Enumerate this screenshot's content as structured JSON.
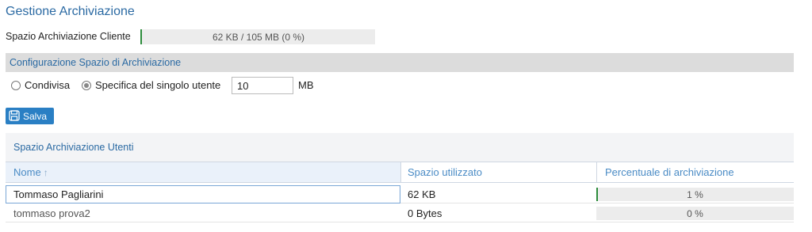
{
  "page": {
    "title": "Gestione Archiviazione"
  },
  "client_quota": {
    "label": "Spazio Archiviazione Cliente",
    "usage_text": "62 KB / 105 MB (0 %)",
    "used_fraction": 0.0
  },
  "storage_config": {
    "section_title": "Configurazione Spazio di Archiviazione",
    "options": [
      {
        "label": "Condivisa",
        "selected": false
      },
      {
        "label": "Specifica del singolo utente",
        "selected": true
      }
    ],
    "per_user_value": "10",
    "unit": "MB",
    "save_label": "Salva"
  },
  "users": {
    "section_title": "Spazio Archiviazione Utenti",
    "columns": {
      "name": "Nome",
      "sort_indicator": "↑",
      "used": "Spazio utilizzato",
      "percent": "Percentuale di archiviazione"
    },
    "rows": [
      {
        "name": "Tommaso Pagliarini",
        "used": "62 KB",
        "percent_text": "1 %",
        "percent": 1,
        "selected": true
      },
      {
        "name": "tommaso prova2",
        "used": "0 Bytes",
        "percent_text": "0 %",
        "percent": 0,
        "selected": false
      }
    ]
  },
  "colors": {
    "accent": "#2b6aa3",
    "button": "#2a7fc4",
    "progress": "#2c8c3b"
  }
}
